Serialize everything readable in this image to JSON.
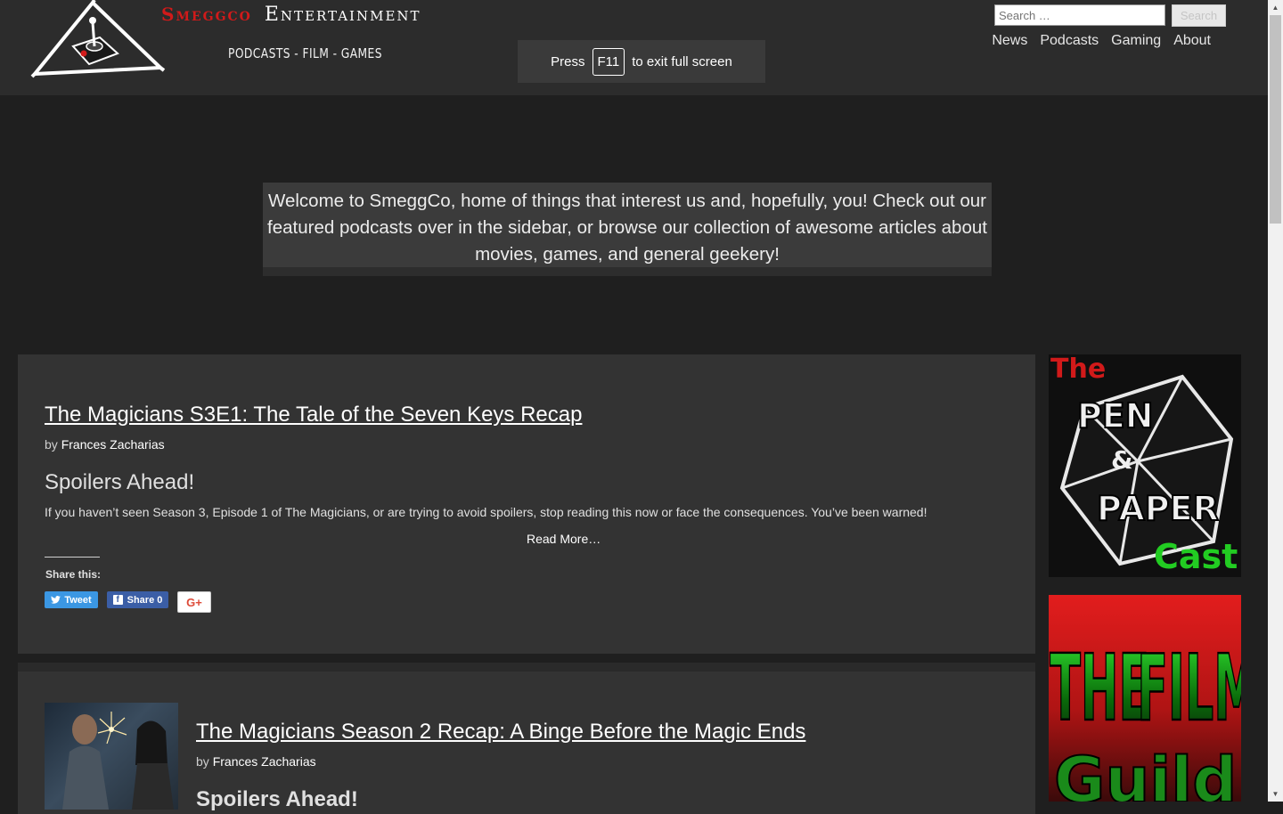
{
  "header": {
    "brand_red": "Smeggco",
    "brand_white": "Entertainment",
    "tagline": "PODCASTS - FILM - GAMES",
    "search_placeholder": "Search …",
    "search_button": "Search",
    "nav": [
      "News",
      "Podcasts",
      "Gaming",
      "About"
    ]
  },
  "fullscreen_toast": {
    "press": "Press",
    "key": "F11",
    "rest": "to exit full screen"
  },
  "welcome": "Welcome to SmeggCo, home of things that interest us and, hopefully, you! Check out our featured podcasts over in the sidebar, or browse our collection of awesome articles about movies, games, and general geekery!",
  "posts": [
    {
      "title": "The Magicians S3E1: The Tale of the Seven Keys Recap",
      "by": "by",
      "author": "Frances Zacharias",
      "spoiler_heading": "Spoilers Ahead!",
      "excerpt": "If you haven’t seen Season 3, Episode 1 of The Magicians, or are trying to avoid spoilers, stop reading this now or face the consequences. You’ve been warned!",
      "read_more": "Read More…",
      "share_label": "Share this:",
      "tweet": "Tweet",
      "share": "Share 0",
      "gplus": "G+"
    },
    {
      "title": "The Magicians Season 2 Recap: A Binge Before the Magic Ends",
      "by": "by",
      "author": "Frances Zacharias",
      "spoiler_heading": "Spoilers Ahead!"
    }
  ],
  "sidebar": {
    "pen_paper": {
      "the": "The",
      "pen": "PEN",
      "amp": "&",
      "paper": "PAPER",
      "cast": "Cast"
    },
    "film_guild": {
      "the": "THE",
      "film": "FILM",
      "guild": "Guild"
    }
  },
  "colors": {
    "brand_red": "#d11a1a",
    "header_bg": "#2c2c2c",
    "page_bg": "#1f1f1f",
    "post_bg": "#333333",
    "tweet_blue": "#3b97e3",
    "facebook_blue": "#3b5ea6"
  }
}
